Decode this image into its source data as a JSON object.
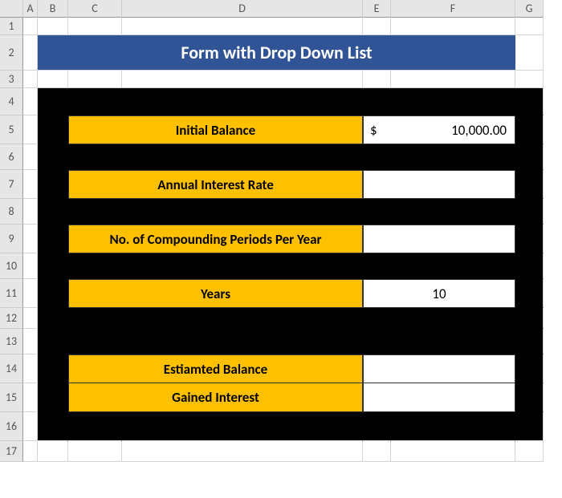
{
  "columns": [
    "A",
    "B",
    "C",
    "D",
    "E",
    "F",
    "G"
  ],
  "rows": [
    "1",
    "2",
    "3",
    "4",
    "5",
    "6",
    "7",
    "8",
    "9",
    "10",
    "11",
    "12",
    "13",
    "14",
    "15",
    "16",
    "17"
  ],
  "title": "Form with Drop Down List",
  "form": {
    "initial_balance": {
      "label": "Initial Balance",
      "currency": "$",
      "value": "10,000.00"
    },
    "annual_rate": {
      "label": "Annual Interest Rate",
      "value": ""
    },
    "compounding": {
      "label": "No. of Compounding Periods Per Year",
      "value": ""
    },
    "years": {
      "label": "Years",
      "value": "10"
    },
    "est_balance": {
      "label": "Estiamted Balance",
      "value": ""
    },
    "gained_interest": {
      "label": "Gained Interest",
      "value": ""
    }
  },
  "chart_data": {
    "type": "table",
    "title": "Form with Drop Down List",
    "series": [
      {
        "name": "Initial Balance",
        "values": [
          10000.0
        ]
      },
      {
        "name": "Annual Interest Rate",
        "values": [
          null
        ]
      },
      {
        "name": "No. of Compounding Periods Per Year",
        "values": [
          null
        ]
      },
      {
        "name": "Years",
        "values": [
          10
        ]
      },
      {
        "name": "Estiamted Balance",
        "values": [
          null
        ]
      },
      {
        "name": "Gained Interest",
        "values": [
          null
        ]
      }
    ]
  }
}
